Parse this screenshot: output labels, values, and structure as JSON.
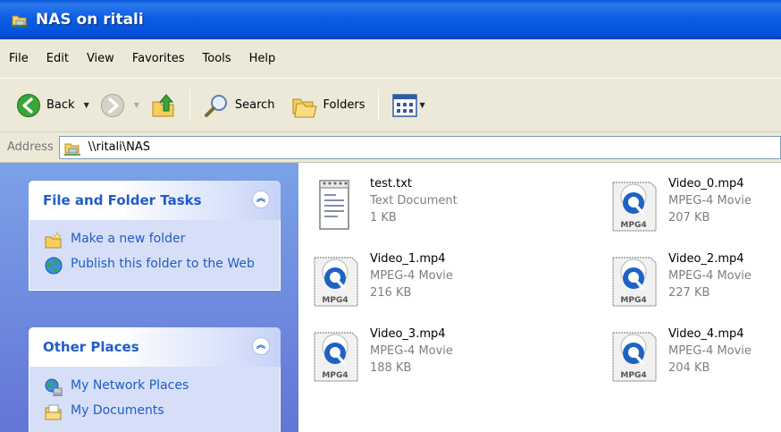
{
  "window": {
    "title": "NAS on ritali"
  },
  "menu": {
    "items": [
      "File",
      "Edit",
      "View",
      "Favorites",
      "Tools",
      "Help"
    ]
  },
  "toolbar": {
    "back": "Back",
    "search": "Search",
    "folders": "Folders"
  },
  "address": {
    "label": "Address",
    "value": "\\\\ritali\\NAS"
  },
  "tasks_panel": {
    "title": "File and Folder Tasks",
    "items": [
      {
        "label": "Make a new folder",
        "icon": "new-folder-icon"
      },
      {
        "label": "Publish this folder to the Web",
        "icon": "publish-web-icon"
      }
    ]
  },
  "places_panel": {
    "title": "Other Places",
    "items": [
      {
        "label": "My Network Places",
        "icon": "network-places-icon"
      },
      {
        "label": "My Documents",
        "icon": "my-documents-icon"
      }
    ]
  },
  "files": [
    {
      "name": "test.txt",
      "type": "Text Document",
      "size": "1 KB",
      "icon": "text-document-icon"
    },
    {
      "name": "Video_0.mp4",
      "type": "MPEG-4 Movie",
      "size": "207 KB",
      "icon": "mpeg4-movie-icon"
    },
    {
      "name": "Video_1.mp4",
      "type": "MPEG-4 Movie",
      "size": "216 KB",
      "icon": "mpeg4-movie-icon"
    },
    {
      "name": "Video_2.mp4",
      "type": "MPEG-4 Movie",
      "size": "227 KB",
      "icon": "mpeg4-movie-icon"
    },
    {
      "name": "Video_3.mp4",
      "type": "MPEG-4 Movie",
      "size": "188 KB",
      "icon": "mpeg4-movie-icon"
    },
    {
      "name": "Video_4.mp4",
      "type": "MPEG-4 Movie",
      "size": "204 KB",
      "icon": "mpeg4-movie-icon"
    }
  ],
  "colors": {
    "title_bar": "#0552d8",
    "link_blue": "#215dc6",
    "pane_blue": "#7ba2e7",
    "chrome": "#ece9d8"
  }
}
